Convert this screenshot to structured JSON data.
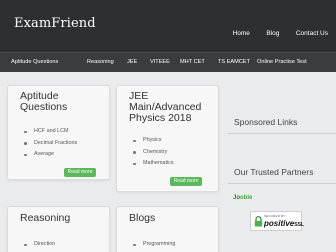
{
  "site": {
    "logo": "ExamFriend"
  },
  "topnav": [
    "Home",
    "Blog",
    "Contact Us"
  ],
  "menu": [
    "Aptitude Questions",
    "Reasoning",
    "JEE",
    "VITEEE",
    "MHT CET",
    "TS EAMCET",
    "Online Practise Test"
  ],
  "cards": [
    {
      "title": "Aptitude Questions",
      "items": [
        "HCF and LCM",
        "Decimal Fractions",
        "Average"
      ],
      "button": "Read more"
    },
    {
      "title": "JEE Main/Advanced Physics 2018",
      "items": [
        "Physics",
        "Chemistry",
        "Mathematics"
      ],
      "button": "Read more"
    },
    {
      "title": "Reasoning",
      "items": [
        "Direction"
      ]
    },
    {
      "title": "Blogs",
      "items": [
        "Programming"
      ]
    }
  ],
  "sidebar": {
    "sponsored": "Sponsored Links",
    "partners": "Our Trusted Partners",
    "jooble": {
      "a": "Jo",
      "b": "oble"
    },
    "ssl": {
      "small": "SECURED BY",
      "big": "positive",
      "suffix": "SSL"
    }
  },
  "colors": {
    "topbar": "#2d2f31",
    "menubar": "#3a3c3f",
    "button": "#5cb85c",
    "background": "#e9ebec"
  }
}
